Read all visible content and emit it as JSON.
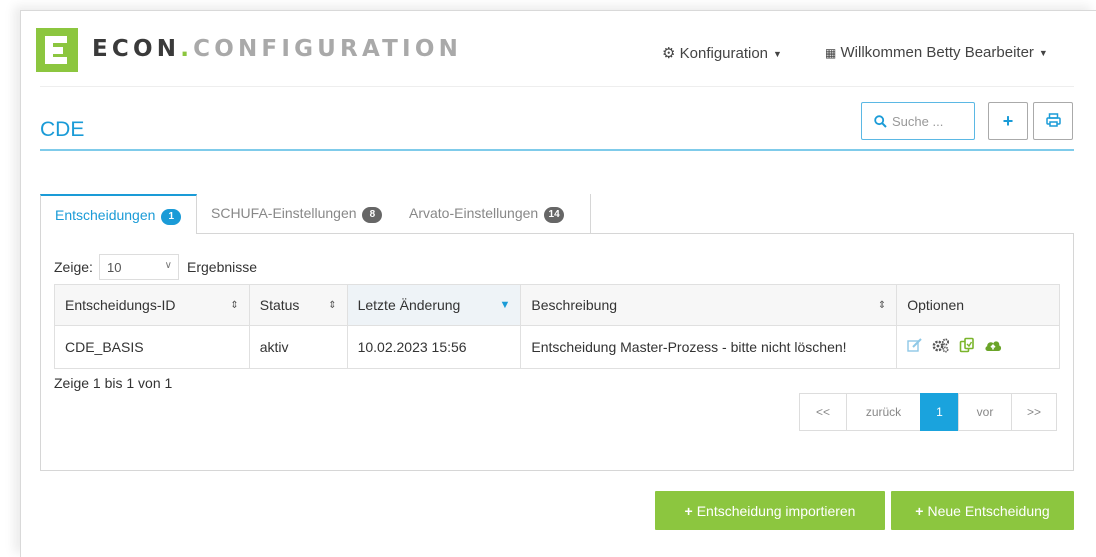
{
  "header": {
    "brand_part1": "ECON",
    "brand_dot": ".",
    "brand_part2": "CONFIGURATION",
    "config_menu": "Konfiguration",
    "user_menu": "Willkommen Betty Bearbeiter"
  },
  "page": {
    "title": "CDE",
    "search_placeholder": "Suche ..."
  },
  "tabs": [
    {
      "label": "Entscheidungen",
      "badge": "1"
    },
    {
      "label": "SCHUFA-Einstellungen",
      "badge": "8"
    },
    {
      "label": "Arvato-Einstellungen",
      "badge": "14"
    }
  ],
  "list_controls": {
    "show_label": "Zeige:",
    "page_size": "10",
    "results_label": "Ergebnisse"
  },
  "table": {
    "columns": [
      "Entscheidungs-ID",
      "Status",
      "Letzte Änderung",
      "Beschreibung",
      "Optionen"
    ],
    "rows": [
      {
        "id": "CDE_BASIS",
        "status": "aktiv",
        "changed": "10.02.2023 15:56",
        "description": "Entscheidung Master-Prozess - bitte nicht löschen!"
      }
    ],
    "option_icons": [
      "edit-icon",
      "settings-icon",
      "copy-icon",
      "cloud-upload-icon"
    ]
  },
  "info_text": "Zeige 1 bis 1 von 1",
  "pagination": {
    "first": "<<",
    "prev": "zurück",
    "current": "1",
    "next": "vor",
    "last": ">>"
  },
  "actions": {
    "import": "Entscheidung importieren",
    "new": "Neue Entscheidung"
  },
  "colors": {
    "accent_blue": "#1a9bd7",
    "brand_green": "#8cc63f"
  }
}
